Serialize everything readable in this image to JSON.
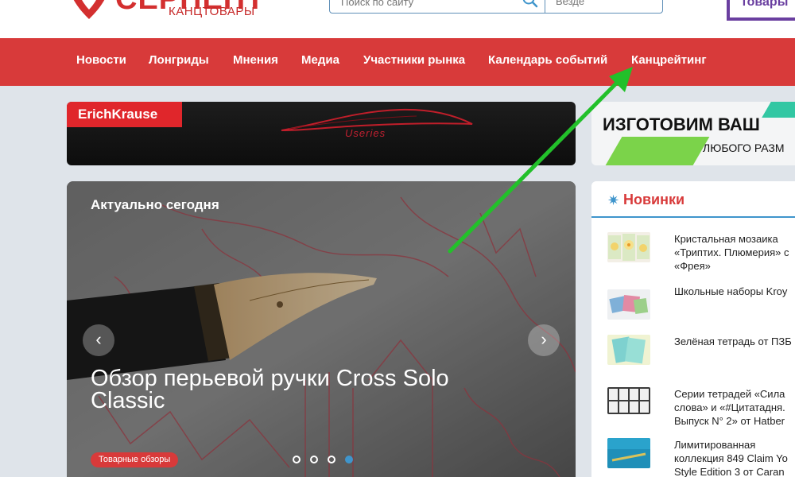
{
  "header": {
    "logo_name": "СЕРПЕНТ",
    "logo_sub": "КАНЦТОВАРЫ",
    "search_placeholder": "Поиск по сайту",
    "search_scope": "Везде",
    "corner_banner_text": "товары"
  },
  "nav": {
    "items": [
      "Новости",
      "Лонгриды",
      "Мнения",
      "Медиа",
      "Участники рынка",
      "Календарь событий",
      "Канцрейтинг"
    ]
  },
  "ads": {
    "left": {
      "brand": "ErichKrause",
      "series": "Useries"
    },
    "right": {
      "title": "ИЗГОТОВИМ ВАШ",
      "subtitle": "ЛЮБОГО РАЗМ"
    }
  },
  "slider": {
    "section": "Актуально сегодня",
    "title": "Обзор перьевой ручки Cross Solo Classic",
    "tag": "Товарные обзоры",
    "prev": "‹",
    "next": "›",
    "dots_total": 4,
    "dots_active_index": 3
  },
  "sidebar": {
    "title": "Новинки",
    "items": [
      {
        "text": "Кристальная мозаика\n«Триптих. Плюмерия» с\n«Фрея»"
      },
      {
        "text": "Школьные наборы Kroy"
      },
      {
        "text": "Зелёная тетрадь от ПЗБ"
      },
      {
        "text": "Серии тетрадей «Сила\nслова» и «#Цитатадня.\nВыпуск N° 2» от Hatber"
      },
      {
        "text": "Лимитированная\nколлекция 849 Claim Yo\nStyle Edition 3 от Caran"
      }
    ]
  },
  "colors": {
    "nav_red": "#d83a3a",
    "accent_blue": "#3f95cc",
    "annotation_green": "#22c02a"
  },
  "icons": [
    "search-icon",
    "chevron-down-icon",
    "chevron-left-icon",
    "chevron-right-icon",
    "star-icon"
  ]
}
